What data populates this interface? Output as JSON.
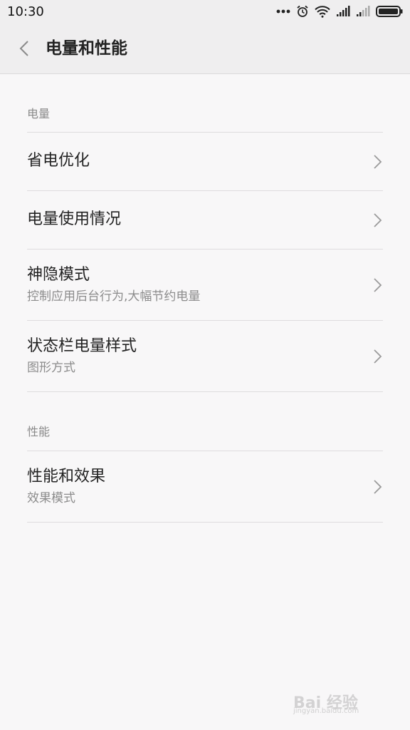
{
  "status_bar": {
    "time": "10:30"
  },
  "header": {
    "title": "电量和性能"
  },
  "sections": [
    {
      "label": "电量",
      "items": [
        {
          "title": "省电优化",
          "subtitle": ""
        },
        {
          "title": "电量使用情况",
          "subtitle": ""
        },
        {
          "title": "神隐模式",
          "subtitle": "控制应用后台行为,大幅节约电量"
        },
        {
          "title": "状态栏电量样式",
          "subtitle": "图形方式"
        }
      ]
    },
    {
      "label": "性能",
      "items": [
        {
          "title": "性能和效果",
          "subtitle": "效果模式"
        }
      ]
    }
  ],
  "watermark": {
    "text": "Bai 经验",
    "sub": "jingyan.baidu.com"
  },
  "icons": {
    "back": "chevron-left-icon",
    "more": "more-dots-icon",
    "alarm": "alarm-icon",
    "wifi": "wifi-icon",
    "signal": "signal-icon",
    "battery": "battery-icon",
    "chevron": "chevron-right-icon"
  }
}
